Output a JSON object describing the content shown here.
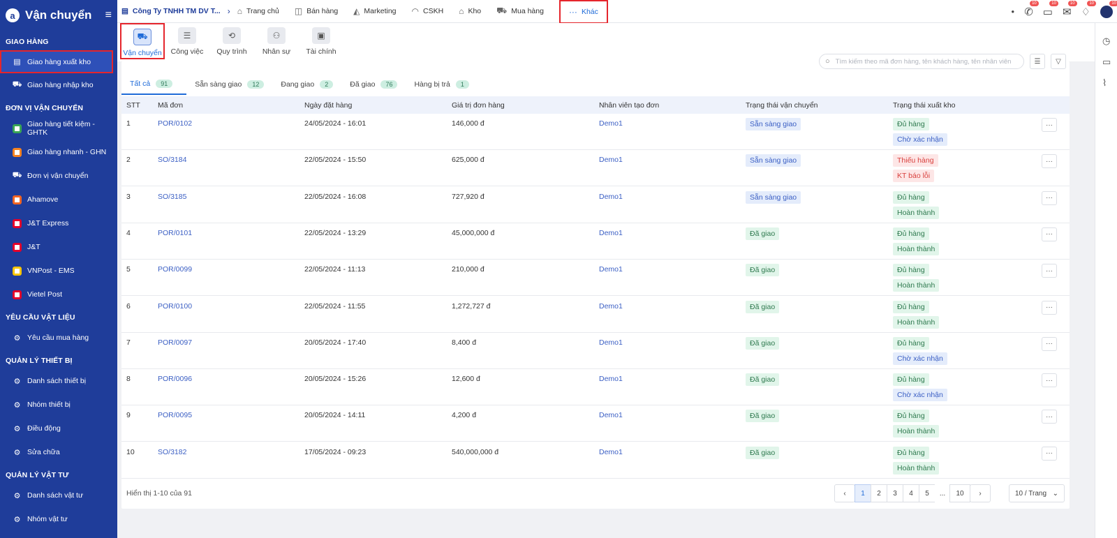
{
  "sidebar": {
    "title": "Vận chuyển",
    "sections": [
      {
        "heading": "GIAO HÀNG",
        "items": [
          {
            "label": "Giao hàng xuất kho",
            "icon": "document-icon",
            "active": true
          },
          {
            "label": "Giao hàng nhập kho",
            "icon": "truck-icon"
          }
        ]
      },
      {
        "heading": "ĐƠN VỊ VẬN CHUYỂN",
        "items": [
          {
            "label": "Giao hàng tiết kiệm - GHTK",
            "icon": "ghtk-logo-icon"
          },
          {
            "label": "Giao hàng nhanh - GHN",
            "icon": "ghn-logo-icon"
          },
          {
            "label": "Đơn vị vận chuyển",
            "icon": "cart-icon"
          },
          {
            "label": "Ahamove",
            "icon": "ahamove-logo-icon"
          },
          {
            "label": "J&T Express",
            "icon": "jt-express-logo-icon"
          },
          {
            "label": "J&T",
            "icon": "jt-logo-icon"
          },
          {
            "label": "VNPost - EMS",
            "icon": "vnpost-logo-icon"
          },
          {
            "label": "Vietel Post",
            "icon": "viettel-logo-icon"
          }
        ]
      },
      {
        "heading": "YÊU CẦU VẬT LIỆU",
        "items": [
          {
            "label": "Yêu cầu mua hàng",
            "icon": "gear-icon"
          }
        ]
      },
      {
        "heading": "QUẢN LÝ THIẾT BỊ",
        "items": [
          {
            "label": "Danh sách thiết bị",
            "icon": "gear-icon"
          },
          {
            "label": "Nhóm thiết bị",
            "icon": "gear-icon"
          },
          {
            "label": "Điều động",
            "icon": "gear-icon"
          },
          {
            "label": "Sửa chữa",
            "icon": "gear-icon"
          }
        ]
      },
      {
        "heading": "QUẢN LÝ VẬT TƯ",
        "items": [
          {
            "label": "Danh sách vật tư",
            "icon": "gear-icon"
          },
          {
            "label": "Nhóm vật tư",
            "icon": "gear-icon"
          }
        ]
      }
    ]
  },
  "topbar": {
    "company": "Công Ty TNHH TM DV T...",
    "nav": [
      {
        "label": "Trang chủ",
        "icon": "home-icon"
      },
      {
        "label": "Bán hàng",
        "icon": "box-icon"
      },
      {
        "label": "Marketing",
        "icon": "megaphone-icon"
      },
      {
        "label": "CSKH",
        "icon": "headset-icon"
      },
      {
        "label": "Kho",
        "icon": "warehouse-icon"
      },
      {
        "label": "Mua hàng",
        "icon": "cart-icon"
      },
      {
        "label": "Khác",
        "icon": "more-icon",
        "active": true
      }
    ],
    "badge_count": "10"
  },
  "modules": [
    {
      "label": "Vận chuyển",
      "icon": "truck-icon",
      "active": true
    },
    {
      "label": "Công việc",
      "icon": "tasks-icon"
    },
    {
      "label": "Quy trình",
      "icon": "process-icon"
    },
    {
      "label": "Nhân sự",
      "icon": "people-icon"
    },
    {
      "label": "Tài chính",
      "icon": "finance-icon"
    }
  ],
  "search": {
    "placeholder": "Tìm kiếm theo mã đơn hàng, tên khách hàng, tên nhân viên"
  },
  "tabs": [
    {
      "label": "Tất cả",
      "count": "91",
      "active": true
    },
    {
      "label": "Sẵn sàng giao",
      "count": "12"
    },
    {
      "label": "Đang giao",
      "count": "2"
    },
    {
      "label": "Đã giao",
      "count": "76"
    },
    {
      "label": "Hàng bị trả",
      "count": "1"
    }
  ],
  "table": {
    "headers": [
      "STT",
      "Mã đơn",
      "Ngày đặt hàng",
      "Giá trị đơn hàng",
      "Nhân viên tạo đơn",
      "Trạng thái vận chuyển",
      "Trạng thái xuất kho"
    ],
    "rows": [
      {
        "stt": "1",
        "code": "POR/0102",
        "date": "24/05/2024 - 16:01",
        "value": "146,000 đ",
        "staff": "Demo1",
        "ship": "Sẵn sàng giao",
        "ship_kind": "blue",
        "stock": [
          {
            "t": "Đủ hàng",
            "k": "green"
          },
          {
            "t": "Chờ xác nhận",
            "k": "blue"
          }
        ]
      },
      {
        "stt": "2",
        "code": "SO/3184",
        "date": "22/05/2024 - 15:50",
        "value": "625,000 đ",
        "staff": "Demo1",
        "ship": "Sẵn sàng giao",
        "ship_kind": "blue",
        "stock": [
          {
            "t": "Thiếu hàng",
            "k": "red"
          },
          {
            "t": "KT báo lỗi",
            "k": "red"
          }
        ]
      },
      {
        "stt": "3",
        "code": "SO/3185",
        "date": "22/05/2024 - 16:08",
        "value": "727,920 đ",
        "staff": "Demo1",
        "ship": "Sẵn sàng giao",
        "ship_kind": "blue",
        "stock": [
          {
            "t": "Đủ hàng",
            "k": "green"
          },
          {
            "t": "Hoàn thành",
            "k": "green"
          }
        ]
      },
      {
        "stt": "4",
        "code": "POR/0101",
        "date": "22/05/2024 - 13:29",
        "value": "45,000,000 đ",
        "staff": "Demo1",
        "ship": "Đã giao",
        "ship_kind": "green",
        "stock": [
          {
            "t": "Đủ hàng",
            "k": "green"
          },
          {
            "t": "Hoàn thành",
            "k": "green"
          }
        ]
      },
      {
        "stt": "5",
        "code": "POR/0099",
        "date": "22/05/2024 - 11:13",
        "value": "210,000 đ",
        "staff": "Demo1",
        "ship": "Đã giao",
        "ship_kind": "green",
        "stock": [
          {
            "t": "Đủ hàng",
            "k": "green"
          },
          {
            "t": "Hoàn thành",
            "k": "green"
          }
        ]
      },
      {
        "stt": "6",
        "code": "POR/0100",
        "date": "22/05/2024 - 11:55",
        "value": "1,272,727 đ",
        "staff": "Demo1",
        "ship": "Đã giao",
        "ship_kind": "green",
        "stock": [
          {
            "t": "Đủ hàng",
            "k": "green"
          },
          {
            "t": "Hoàn thành",
            "k": "green"
          }
        ]
      },
      {
        "stt": "7",
        "code": "POR/0097",
        "date": "20/05/2024 - 17:40",
        "value": "8,400 đ",
        "staff": "Demo1",
        "ship": "Đã giao",
        "ship_kind": "green",
        "stock": [
          {
            "t": "Đủ hàng",
            "k": "green"
          },
          {
            "t": "Chờ xác nhận",
            "k": "blue"
          }
        ]
      },
      {
        "stt": "8",
        "code": "POR/0096",
        "date": "20/05/2024 - 15:26",
        "value": "12,600 đ",
        "staff": "Demo1",
        "ship": "Đã giao",
        "ship_kind": "green",
        "stock": [
          {
            "t": "Đủ hàng",
            "k": "green"
          },
          {
            "t": "Chờ xác nhận",
            "k": "blue"
          }
        ]
      },
      {
        "stt": "9",
        "code": "POR/0095",
        "date": "20/05/2024 - 14:11",
        "value": "4,200 đ",
        "staff": "Demo1",
        "ship": "Đã giao",
        "ship_kind": "green",
        "stock": [
          {
            "t": "Đủ hàng",
            "k": "green"
          },
          {
            "t": "Hoàn thành",
            "k": "green"
          }
        ]
      },
      {
        "stt": "10",
        "code": "SO/3182",
        "date": "17/05/2024 - 09:23",
        "value": "540,000,000 đ",
        "staff": "Demo1",
        "ship": "Đã giao",
        "ship_kind": "green",
        "stock": [
          {
            "t": "Đủ hàng",
            "k": "green"
          },
          {
            "t": "Hoàn thành",
            "k": "green"
          }
        ]
      }
    ],
    "row_action": "···"
  },
  "footer": {
    "summary": "Hiển thị 1-10 của 91",
    "pages": [
      "1",
      "2",
      "3",
      "4",
      "5",
      "...",
      "10"
    ],
    "current_page": "1",
    "per_page": "10 / Trang"
  },
  "colors": {
    "sidebar": "#1f3d9a",
    "accent": "#1f6bd8",
    "highlight": "#e5252c"
  }
}
